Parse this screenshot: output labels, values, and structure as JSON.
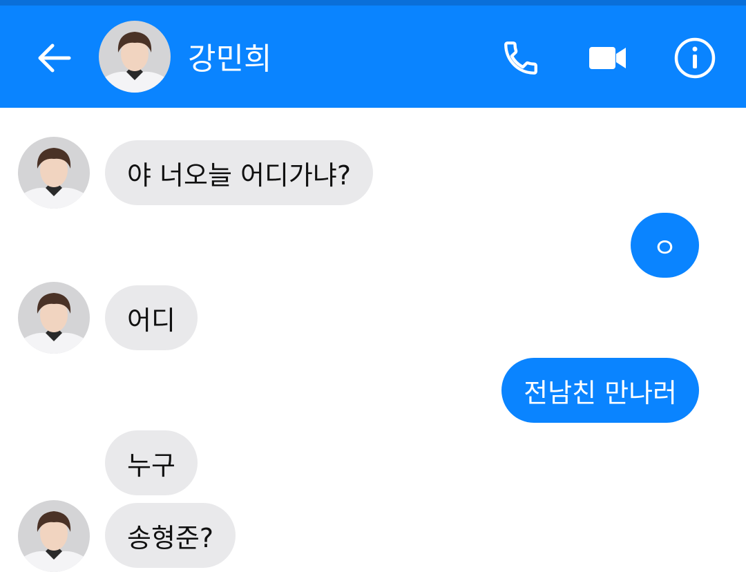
{
  "header": {
    "contact_name": "강민희",
    "back_icon": "back-arrow-icon",
    "call_icon": "phone-icon",
    "video_icon": "video-camera-icon",
    "info_icon": "info-icon"
  },
  "colors": {
    "brand_blue": "#0a84ff",
    "incoming_bubble": "#e9e9eb",
    "outgoing_text": "#ffffff"
  },
  "messages": [
    {
      "direction": "in",
      "text": "야 너오늘 어디가냐?",
      "show_avatar": true
    },
    {
      "direction": "out",
      "text": "ㅇ"
    },
    {
      "direction": "in",
      "text": "어디",
      "show_avatar": true
    },
    {
      "direction": "out",
      "text": "전남친 만나러"
    },
    {
      "direction": "in",
      "text": "누구",
      "show_avatar": false
    },
    {
      "direction": "in",
      "text": "송형준?",
      "show_avatar": true
    }
  ]
}
